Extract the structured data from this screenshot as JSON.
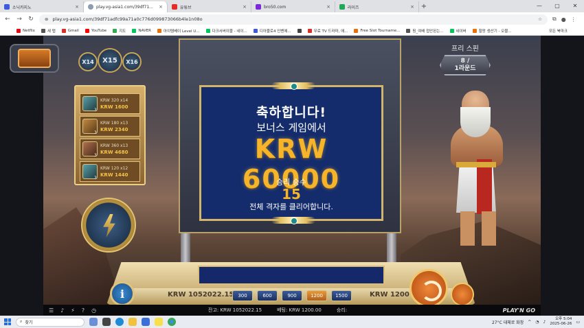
{
  "browser": {
    "tabs": [
      {
        "label": "소닉카지노",
        "color": "#3b5bdb",
        "active": false
      },
      {
        "label": "play.vg-asia1.com/39df71...",
        "color": "#8e9bb0",
        "active": true
      },
      {
        "label": "유튜브",
        "color": "#e52d27",
        "active": false
      },
      {
        "label": "bro50.com",
        "color": "#7b2bd3",
        "active": false
      },
      {
        "label": "라이즈",
        "color": "#1fa855",
        "active": false
      }
    ],
    "new_tab": "+",
    "url": "play.vg-asia1.com/39df71adfc99a71a0c776d099873066b4le1n08o",
    "bookmarks": [
      {
        "label": "Netflix",
        "color": "#e50914"
      },
      {
        "label": "새 탭",
        "color": "#555555"
      },
      {
        "label": "Gmail",
        "color": "#d93025"
      },
      {
        "label": "YouTube",
        "color": "#ff0000"
      },
      {
        "label": "지도",
        "color": "#34a853"
      },
      {
        "label": "NAVER",
        "color": "#03c75a"
      },
      {
        "label": "아이템베이 Level U...",
        "color": "#e8710a"
      },
      {
        "label": "다크서버이블 - 네이...",
        "color": "#03c75a"
      },
      {
        "label": "디아블로4 인벤에...",
        "color": "#3b5bdb"
      },
      {
        "label": "",
        "color": "#444444"
      },
      {
        "label": "무료 TV 드라마, 애...",
        "color": "#d93025"
      },
      {
        "label": "Free Slot Tourname...",
        "color": "#e8710a"
      },
      {
        "label": "핑_여배 접안된는...",
        "color": "#555555"
      },
      {
        "label": "네이버",
        "color": "#03c75a"
      },
      {
        "label": "할랑 생산기 - 오블...",
        "color": "#e8710a"
      }
    ],
    "all_bookmarks": "모든 북마크"
  },
  "game": {
    "multipliers": [
      "X14",
      "X15",
      "X16"
    ],
    "paytable": [
      {
        "label": "KRW 320 x14",
        "amount": "KRW 1600",
        "count": "3"
      },
      {
        "label": "KRW 180 x13",
        "amount": "KRW 2340",
        "count": "3"
      },
      {
        "label": "KRW 360 x13",
        "amount": "KRW 4680",
        "count": "3"
      },
      {
        "label": "KRW 120 x12",
        "amount": "KRW 1440",
        "count": "3"
      }
    ],
    "free_spins": {
      "label": "프리 스핀",
      "count": "8 /",
      "rounds": "1라운드"
    },
    "popup": {
      "congrats": "축하합니다!",
      "bonus": "보너스 게임에서",
      "amount": "KRW 60000",
      "wins_label": "승리 승수",
      "wins_count": "15",
      "click_all": "전체 격자를 클리어합니다."
    },
    "balance_left": "KRW 1052022.15",
    "balance_right": "KRW 1200",
    "bets": [
      {
        "value": "300",
        "selected": false
      },
      {
        "value": "600",
        "selected": false
      },
      {
        "value": "900",
        "selected": false
      },
      {
        "value": "1200",
        "selected": true
      },
      {
        "value": "1500",
        "selected": false
      }
    ],
    "info_label": "i",
    "status": {
      "balance": "잔고: KRW 1052022.15",
      "bet": "베팅: KRW 1200.00",
      "win": "승리:",
      "brand": "PLAY'N GO"
    }
  },
  "taskbar": {
    "search_placeholder": "찾기",
    "weather": "27°C  대체로 화창",
    "time": "오후 5:04",
    "date": "2025-06-26"
  }
}
